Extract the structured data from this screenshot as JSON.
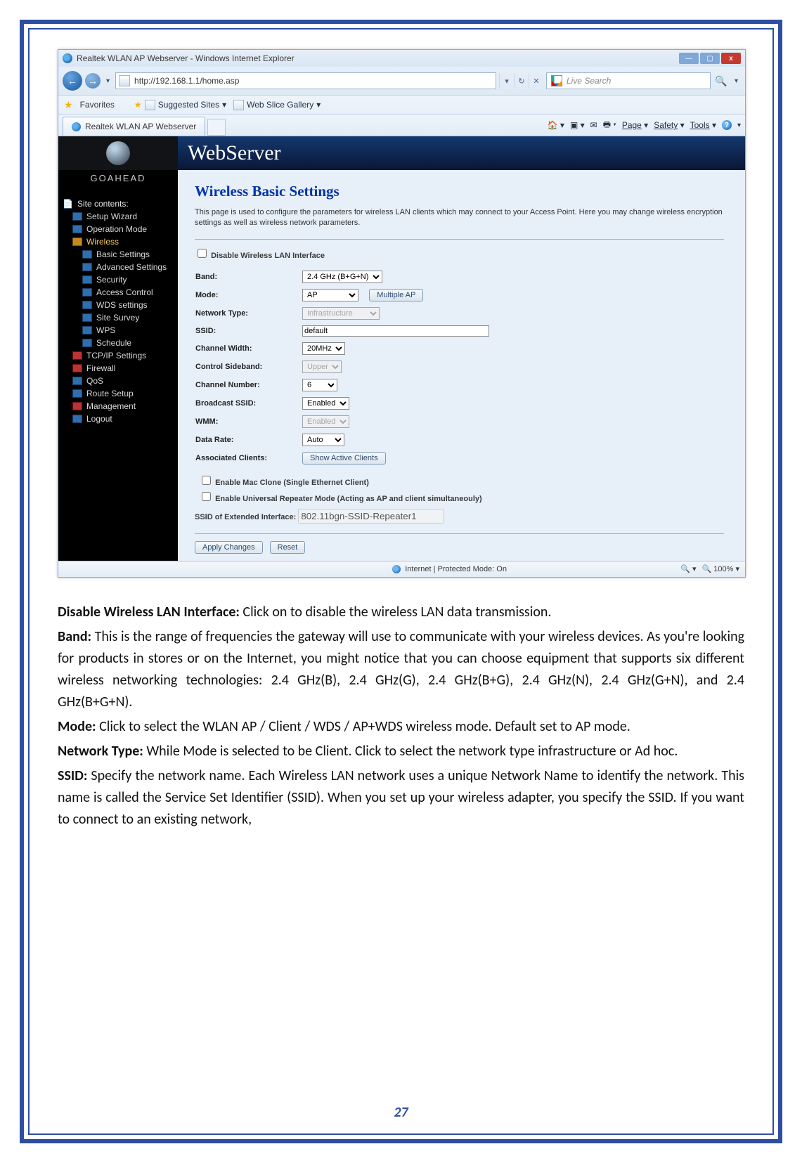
{
  "window": {
    "title": "Realtek WLAN AP Webserver - Windows Internet Explorer",
    "url": "http://192.168.1.1/home.asp",
    "search_placeholder": "Live Search",
    "fav_label": "Favorites",
    "suggested_sites": "Suggested Sites",
    "web_slice": "Web Slice Gallery",
    "tab_title": "Realtek WLAN AP Webserver",
    "cmd": {
      "page": "Page",
      "safety": "Safety",
      "tools": "Tools"
    }
  },
  "banner": "WebServer",
  "brand": "GOAHEAD",
  "nav": {
    "root": "Site contents:",
    "items": [
      "Setup Wizard",
      "Operation Mode",
      "Wireless",
      "Basic Settings",
      "Advanced Settings",
      "Security",
      "Access Control",
      "WDS settings",
      "Site Survey",
      "WPS",
      "Schedule",
      "TCP/IP Settings",
      "Firewall",
      "QoS",
      "Route Setup",
      "Management",
      "Logout"
    ]
  },
  "form": {
    "heading": "Wireless Basic Settings",
    "desc": "This page is used to configure the parameters for wireless LAN clients which may connect to your Access Point. Here you may change wireless encryption settings as well as wireless network parameters.",
    "disable_label": "Disable Wireless LAN Interface",
    "labels": {
      "band": "Band:",
      "mode": "Mode:",
      "net_type": "Network Type:",
      "ssid": "SSID:",
      "ch_width": "Channel Width:",
      "ctrl_sb": "Control Sideband:",
      "ch_num": "Channel Number:",
      "bcast": "Broadcast SSID:",
      "wmm": "WMM:",
      "data_rate": "Data Rate:",
      "assoc": "Associated Clients:",
      "mac_clone": "Enable Mac Clone (Single Ethernet Client)",
      "urepeater": "Enable Universal Repeater Mode (Acting as AP and client simultaneouly)",
      "ext_ssid": "SSID of Extended Interface:"
    },
    "values": {
      "band": "2.4 GHz (B+G+N)",
      "mode": "AP",
      "multi_ap": "Multiple AP",
      "net_type": "Infrastructure",
      "ssid": "default",
      "ch_width": "20MHz",
      "ctrl_sb": "Upper",
      "ch_num": "6",
      "bcast": "Enabled",
      "wmm": "Enabled",
      "data_rate": "Auto",
      "show_clients": "Show Active Clients",
      "ext_ssid": "802.11bgn-SSID-Repeater1",
      "apply": "Apply Changes",
      "reset": "Reset"
    }
  },
  "status": {
    "mode": "Internet | Protected Mode: On",
    "zoom": "100%"
  },
  "doc": {
    "p1_label": "Disable Wireless LAN Interface:",
    "p1": " Click on to disable the wireless LAN data transmission.",
    "p2_label": "Band:",
    "p2": " This is the range of frequencies the gateway will use to communicate with your wireless devices. As you're looking for products in stores or on the Internet, you might notice that you can choose equipment that supports six different wireless networking technologies: 2.4 GHz(B), 2.4 GHz(G), 2.4 GHz(B+G), 2.4 GHz(N), 2.4 GHz(G+N), and 2.4 GHz(B+G+N).",
    "p3_label": "Mode:",
    "p3": " Click to select the WLAN AP / Client / WDS / AP+WDS wireless mode. Default set to AP mode.",
    "p4_label": "Network Type:",
    "p4": " While Mode is selected to be Client. Click to select the network type infrastructure or Ad hoc.",
    "p5_label": "SSID:",
    "p5": " Specify the network name. Each Wireless LAN network uses a unique Network Name to identify the network. This name is called the Service Set Identifier (SSID). When you set up your wireless adapter, you specify the SSID. If you want to connect to an existing network,"
  },
  "page_number": "27"
}
